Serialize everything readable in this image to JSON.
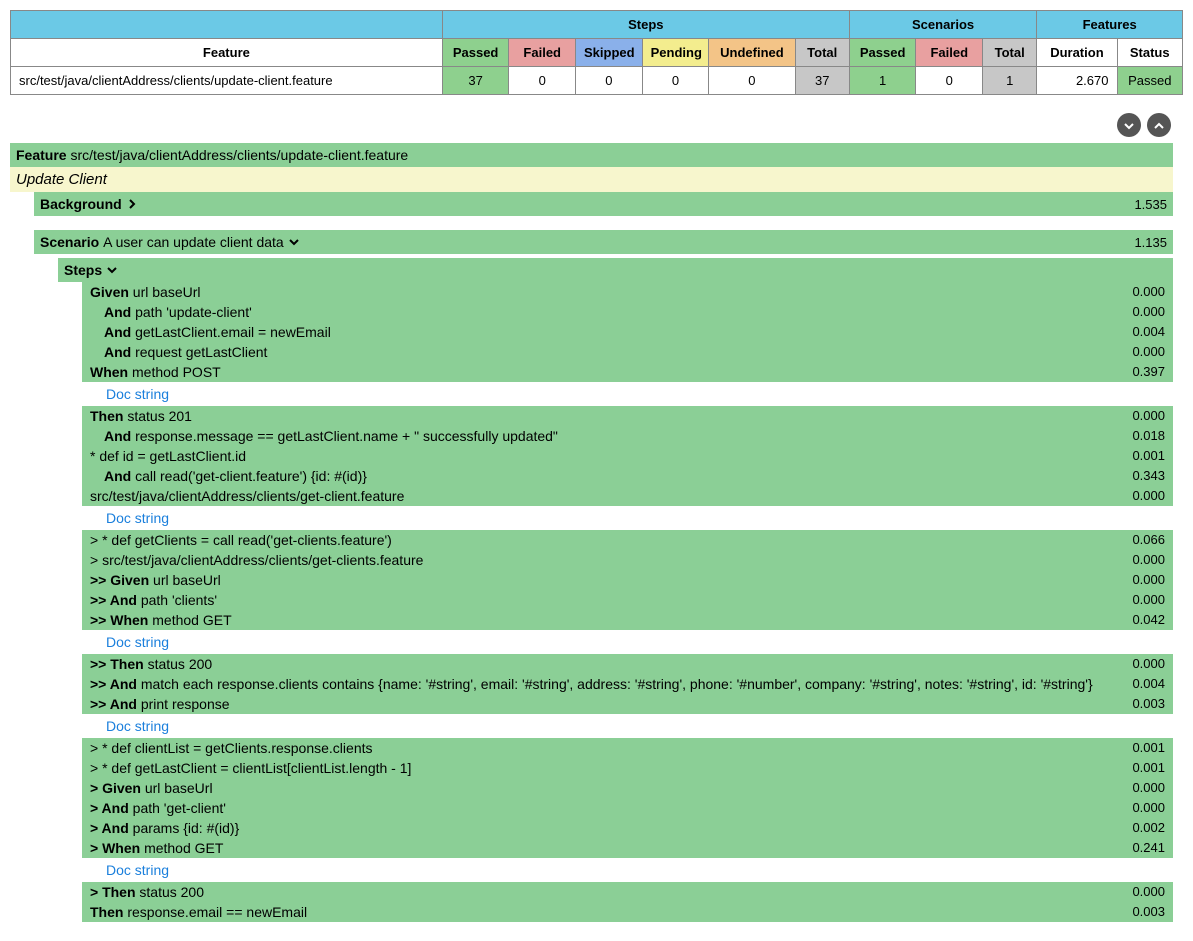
{
  "summary": {
    "group_headers": {
      "steps": "Steps",
      "scenarios": "Scenarios",
      "features": "Features"
    },
    "col_headers": {
      "feature": "Feature",
      "passed": "Passed",
      "failed": "Failed",
      "skipped": "Skipped",
      "pending": "Pending",
      "undefined": "Undefined",
      "total": "Total",
      "sc_passed": "Passed",
      "sc_failed": "Failed",
      "sc_total": "Total",
      "duration": "Duration",
      "status": "Status"
    },
    "row": {
      "feature": "src/test/java/clientAddress/clients/update-client.feature",
      "passed": "37",
      "failed": "0",
      "skipped": "0",
      "pending": "0",
      "undefined": "0",
      "total": "37",
      "sc_passed": "1",
      "sc_failed": "0",
      "sc_total": "1",
      "duration": "2.670",
      "status": "Passed"
    }
  },
  "feature": {
    "label": "Feature",
    "path": "src/test/java/clientAddress/clients/update-client.feature",
    "title": "Update Client"
  },
  "background": {
    "label": "Background",
    "time": "1.535"
  },
  "scenario": {
    "label": "Scenario",
    "name": "A user can update client data",
    "time": "1.135"
  },
  "steps_header": {
    "label": "Steps"
  },
  "doc_string_label": "Doc string",
  "blocks": [
    {
      "rows": [
        {
          "kw": "Given",
          "txt": "url baseUrl",
          "dur": "0.000",
          "indent": false
        },
        {
          "kw": "And",
          "txt": "path 'update-client'",
          "dur": "0.000",
          "indent": true
        },
        {
          "kw": "And",
          "txt": "getLastClient.email = newEmail",
          "dur": "0.004",
          "indent": true
        },
        {
          "kw": "And",
          "txt": "request getLastClient",
          "dur": "0.000",
          "indent": true
        },
        {
          "kw": "When",
          "txt": "method POST",
          "dur": "0.397",
          "indent": false
        }
      ],
      "doc_after": true
    },
    {
      "rows": [
        {
          "kw": "Then",
          "txt": "status 201",
          "dur": "0.000",
          "indent": false
        },
        {
          "kw": "And",
          "txt": "response.message == getLastClient.name + \" successfully updated\"",
          "dur": "0.018",
          "indent": true
        },
        {
          "kw": "",
          "txt": "* def id = getLastClient.id",
          "dur": "0.001",
          "indent": false
        },
        {
          "kw": "And",
          "txt": "call read('get-client.feature') {id: #(id)}",
          "dur": "0.343",
          "indent": true
        },
        {
          "kw": "",
          "txt": "src/test/java/clientAddress/clients/get-client.feature",
          "dur": "0.000",
          "indent": false
        }
      ],
      "doc_after": true
    },
    {
      "rows": [
        {
          "kw": "",
          "txt": "> * def getClients = call read('get-clients.feature')",
          "dur": "0.066",
          "indent": false
        },
        {
          "kw": "",
          "txt": "> src/test/java/clientAddress/clients/get-clients.feature",
          "dur": "0.000",
          "indent": false
        },
        {
          "kw": ">> Given",
          "txt": "url baseUrl",
          "dur": "0.000",
          "indent": false
        },
        {
          "kw": ">> And",
          "txt": "path 'clients'",
          "dur": "0.000",
          "indent": false
        },
        {
          "kw": ">> When",
          "txt": "method GET",
          "dur": "0.042",
          "indent": false
        }
      ],
      "doc_after": true
    },
    {
      "rows": [
        {
          "kw": ">> Then",
          "txt": "status 200",
          "dur": "0.000",
          "indent": false
        },
        {
          "kw": ">> And",
          "txt": "match each response.clients contains {name: '#string', email: '#string', address: '#string', phone: '#number', company: '#string', notes: '#string', id: '#string'}",
          "dur": "0.004",
          "indent": false
        },
        {
          "kw": ">> And",
          "txt": "print response",
          "dur": "0.003",
          "indent": false
        }
      ],
      "doc_after": true
    },
    {
      "rows": [
        {
          "kw": "",
          "txt": "> * def clientList = getClients.response.clients",
          "dur": "0.001",
          "indent": false
        },
        {
          "kw": "",
          "txt": "> * def getLastClient = clientList[clientList.length - 1]",
          "dur": "0.001",
          "indent": false
        },
        {
          "kw": "> Given",
          "txt": "url baseUrl",
          "dur": "0.000",
          "indent": false
        },
        {
          "kw": "> And",
          "txt": "path 'get-client'",
          "dur": "0.000",
          "indent": false
        },
        {
          "kw": "> And",
          "txt": "params {id: #(id)}",
          "dur": "0.002",
          "indent": false
        },
        {
          "kw": "> When",
          "txt": "method GET",
          "dur": "0.241",
          "indent": false
        }
      ],
      "doc_after": true
    },
    {
      "rows": [
        {
          "kw": "> Then",
          "txt": "status 200",
          "dur": "0.000",
          "indent": false
        },
        {
          "kw": "Then",
          "txt": "response.email == newEmail",
          "dur": "0.003",
          "indent": false
        }
      ],
      "doc_after": false
    }
  ]
}
